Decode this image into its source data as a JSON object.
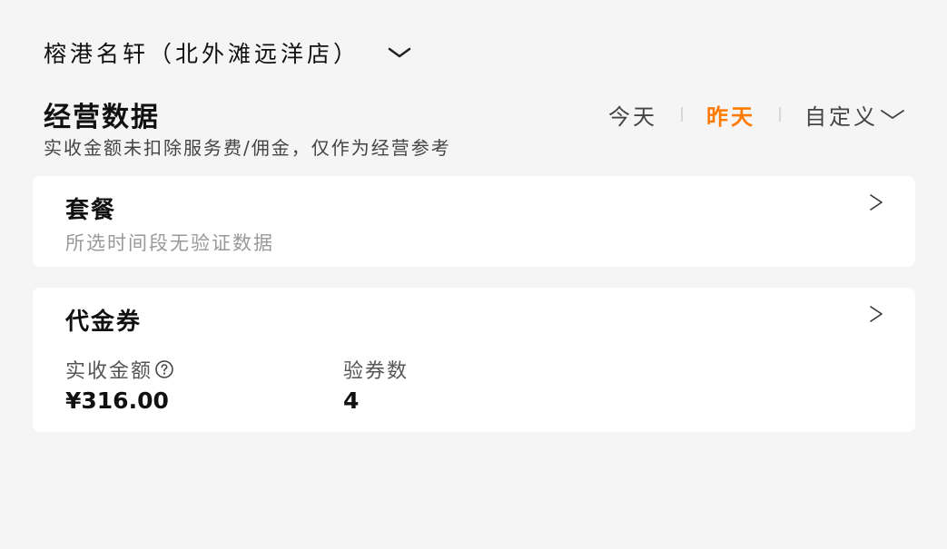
{
  "store": {
    "name": "榕港名轩（北外滩远洋店）",
    "chevron_icon": "chevron-down-icon"
  },
  "overview": {
    "title": "经营数据",
    "subtitle": "实收金额未扣除服务费/佣金，仅作为经营参考",
    "date_tabs": [
      {
        "label": "今天",
        "active": false
      },
      {
        "label": "昨天",
        "active": true
      },
      {
        "label": "自定义",
        "active": false
      }
    ],
    "accent_color": "#ff7a00"
  },
  "combo_card": {
    "title": "套餐",
    "empty_text": "所选时间段无验证数据",
    "arrow_icon": "chevron-right-icon"
  },
  "voucher_card": {
    "title": "代金券",
    "arrow_icon": "chevron-right-icon",
    "metrics": [
      {
        "label": "实收金额",
        "value": "¥316.00",
        "help_icon": "question-circle-icon"
      },
      {
        "label": "验券数",
        "value": "4"
      }
    ]
  }
}
